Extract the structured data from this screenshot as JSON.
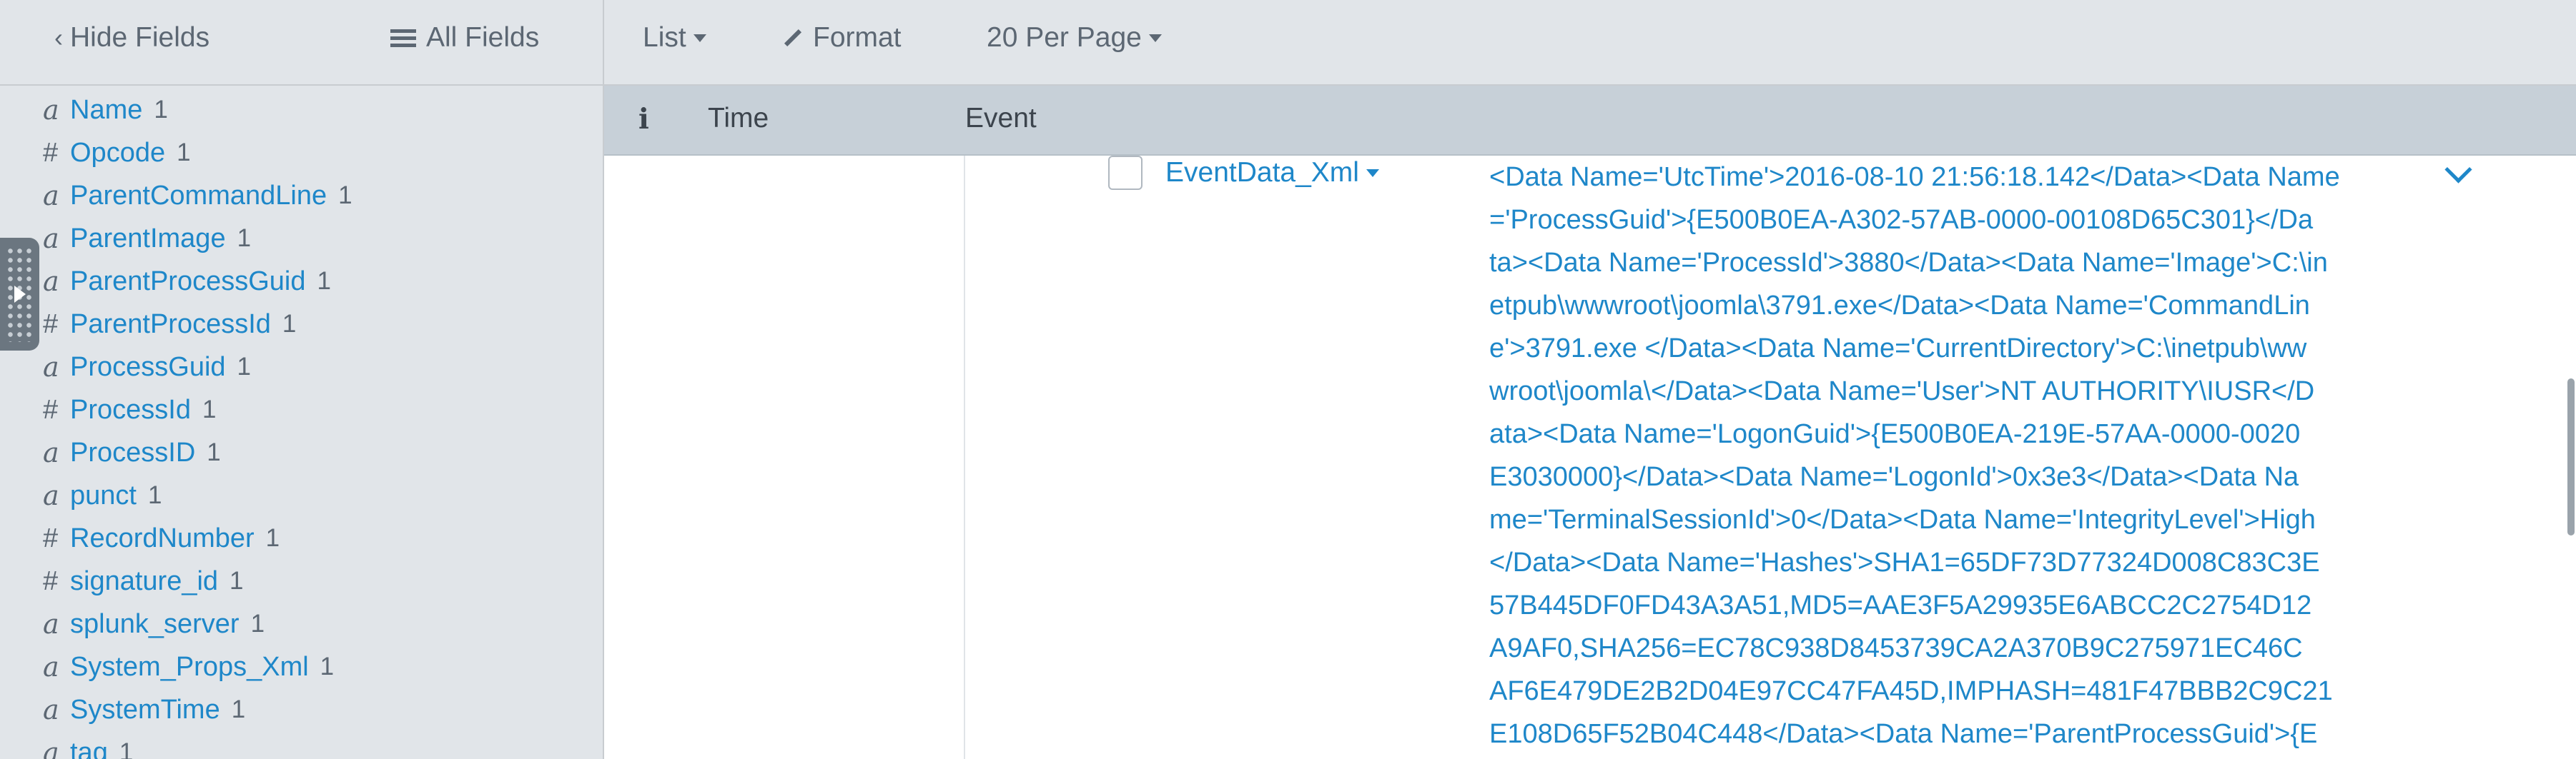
{
  "sidebar": {
    "hide_fields_label": "Hide Fields",
    "all_fields_label": "All Fields",
    "fields": [
      {
        "type": "a",
        "name": "Name",
        "count": "1"
      },
      {
        "type": "#",
        "name": "Opcode",
        "count": "1"
      },
      {
        "type": "a",
        "name": "ParentCommandLine",
        "count": "1"
      },
      {
        "type": "a",
        "name": "ParentImage",
        "count": "1"
      },
      {
        "type": "a",
        "name": "ParentProcessGuid",
        "count": "1"
      },
      {
        "type": "#",
        "name": "ParentProcessId",
        "count": "1"
      },
      {
        "type": "a",
        "name": "ProcessGuid",
        "count": "1"
      },
      {
        "type": "#",
        "name": "ProcessId",
        "count": "1"
      },
      {
        "type": "a",
        "name": "ProcessID",
        "count": "1"
      },
      {
        "type": "a",
        "name": "punct",
        "count": "1"
      },
      {
        "type": "#",
        "name": "RecordNumber",
        "count": "1"
      },
      {
        "type": "#",
        "name": "signature_id",
        "count": "1"
      },
      {
        "type": "a",
        "name": "splunk_server",
        "count": "1"
      },
      {
        "type": "a",
        "name": "System_Props_Xml",
        "count": "1"
      },
      {
        "type": "a",
        "name": "SystemTime",
        "count": "1"
      },
      {
        "type": "a",
        "name": "tag",
        "count": "1"
      }
    ]
  },
  "toolbar": {
    "list_label": "List",
    "format_label": "Format",
    "per_page_label": "20 Per Page"
  },
  "columns": {
    "info": "i",
    "time": "Time",
    "event": "Event"
  },
  "event": {
    "field_name": "EventData_Xml",
    "value_lines": [
      "<Data Name='UtcTime'>2016-08-10 21:56:18.142</Data><Data Name",
      "='ProcessGuid'>{E500B0EA-A302-57AB-0000-00108D65C301}</Da",
      "ta><Data Name='ProcessId'>3880</Data><Data Name='Image'>C:\\in",
      "etpub\\wwwroot\\joomla\\3791.exe</Data><Data Name='CommandLin",
      "e'>3791.exe </Data><Data Name='CurrentDirectory'>C:\\inetpub\\ww",
      "wroot\\joomla\\</Data><Data Name='User'>NT AUTHORITY\\IUSR</D",
      "ata><Data Name='LogonGuid'>{E500B0EA-219E-57AA-0000-0020",
      "E3030000}</Data><Data Name='LogonId'>0x3e3</Data><Data Na",
      "me='TerminalSessionId'>0</Data><Data Name='IntegrityLevel'>High",
      "</Data><Data Name='Hashes'>SHA1=65DF73D77324D008C83C3E",
      "57B445DF0FD43A3A51,MD5=AAE3F5A29935E6ABCC2C2754D12",
      "A9AF0,SHA256=EC78C938D8453739CA2A370B9C275971EC46C",
      "AF6E479DE2B2D04E97CC47FA45D,IMPHASH=481F47BBB2C9C21",
      "E108D65F52B04C448</Data><Data Name='ParentProcessGuid'>{E"
    ]
  },
  "colors": {
    "link": "#1e87c9",
    "sidebar_bg": "#e1e5e9",
    "header_bg": "#c7d0d8",
    "muted_text": "#5c6773"
  }
}
